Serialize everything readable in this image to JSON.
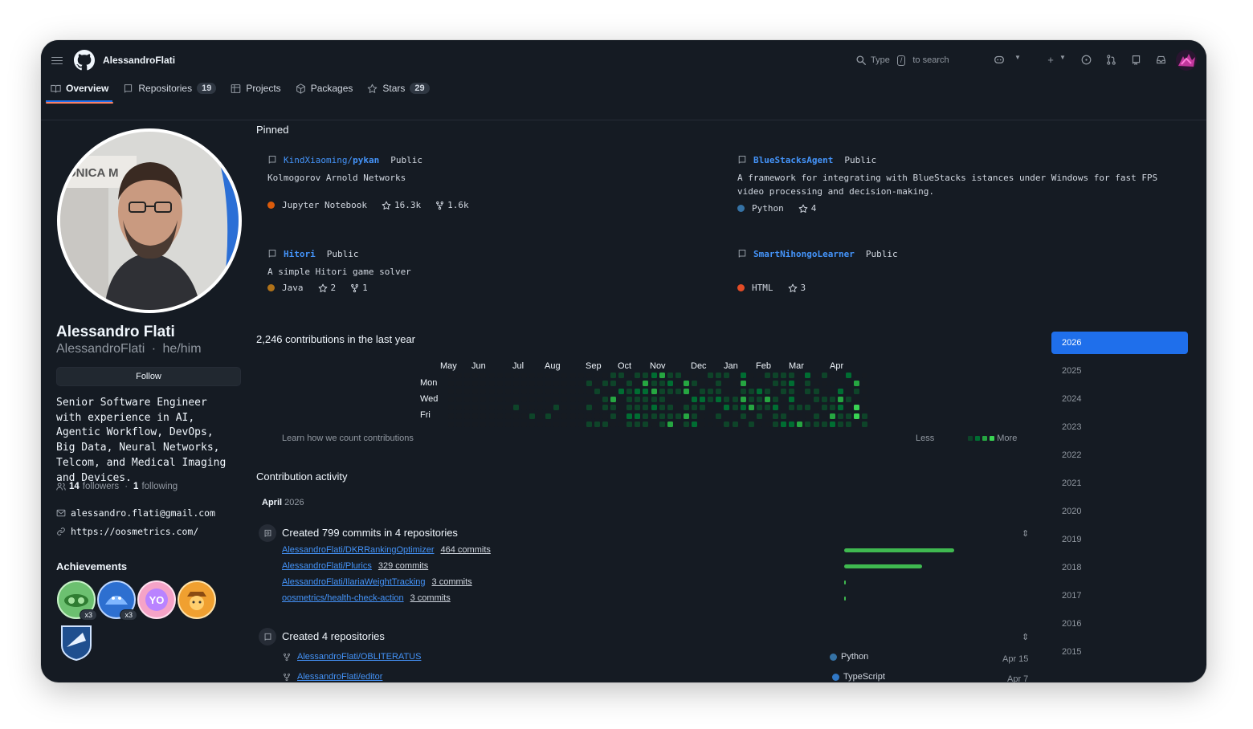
{
  "header": {
    "owner": "AlessandroFlati",
    "search_prefix": "Type",
    "search_key": "/",
    "search_suffix": "to search"
  },
  "tabs": [
    {
      "label": "Overview"
    },
    {
      "label": "Repositories",
      "count": "19"
    },
    {
      "label": "Projects"
    },
    {
      "label": "Packages"
    },
    {
      "label": "Stars",
      "count": "29"
    }
  ],
  "profile": {
    "name": "Alessandro Flati",
    "handle": "AlessandroFlati",
    "pronouns": "he/him",
    "follow_label": "Follow",
    "bio": "Senior Software Engineer with experience in AI, Agentic Workflow, DevOps, Big Data, Neural Networks, Telcom, and Medical Imaging and Devices.",
    "followers": "14",
    "followers_label": "followers",
    "following": "1",
    "following_label": "following",
    "email": "alessandro.flati@gmail.com",
    "website": "https://oosmetrics.com/",
    "photo_text": "ONICA M"
  },
  "achievements": {
    "title": "Achievements",
    "badges": [
      {
        "name": "pair-extraordinaire",
        "count": "x3"
      },
      {
        "name": "pull-shark",
        "count": "x3"
      },
      {
        "name": "yolo",
        "count": ""
      },
      {
        "name": "quickdraw",
        "count": ""
      },
      {
        "name": "arctic-code-vault",
        "count": ""
      }
    ]
  },
  "pinned": {
    "title": "Pinned",
    "items": [
      {
        "owner": "KindXiaoming/",
        "repo": "pykan",
        "visibility": "Public",
        "description": "Kolmogorov Arnold Networks",
        "language": "Jupyter Notebook",
        "lang_color": "#da5b0b",
        "stars": "16.3k",
        "forks": "1.6k"
      },
      {
        "owner": "",
        "repo": "BlueStacksAgent",
        "visibility": "Public",
        "description": "A framework for integrating with BlueStacks istances under Windows for fast FPS video processing and decision-making.",
        "language": "Python",
        "lang_color": "#3572a5",
        "stars": "4",
        "forks": ""
      },
      {
        "owner": "",
        "repo": "Hitori",
        "visibility": "Public",
        "description": "A simple Hitori game solver",
        "language": "Java",
        "lang_color": "#b07219",
        "stars": "2",
        "forks": "1"
      },
      {
        "owner": "",
        "repo": "SmartNihongoLearner",
        "visibility": "Public",
        "description": "",
        "language": "HTML",
        "lang_color": "#e34c26",
        "stars": "3",
        "forks": ""
      }
    ]
  },
  "contributions": {
    "title": "2,246 contributions in the last year",
    "months": [
      "May",
      "Jun",
      "Jul",
      "Aug",
      "Sep",
      "Oct",
      "Nov",
      "Dec",
      "Jan",
      "Feb",
      "Mar",
      "Apr"
    ],
    "days": [
      "Mon",
      "Wed",
      "Fri"
    ],
    "learn_link": "Learn how we count contributions",
    "legend_less": "Less",
    "legend_more": "More",
    "colors": [
      "#161b22",
      "#0e4429",
      "#006d32",
      "#26a641",
      "#39d353"
    ]
  },
  "years": [
    "2026",
    "2025",
    "2024",
    "2023",
    "2022",
    "2021",
    "2020",
    "2019",
    "2018",
    "2017",
    "2016",
    "2015"
  ],
  "activity": {
    "title": "Contribution activity",
    "month": "April",
    "year": "2026",
    "commits_title": "Created 799 commits in 4 repositories",
    "commits": [
      {
        "repo": "AlessandroFlati/DKRRankingOptimizer",
        "count": "464 commits",
        "share": 0.58
      },
      {
        "repo": "AlessandroFlati/Plurics",
        "count": "329 commits",
        "share": 0.41
      },
      {
        "repo": "AlessandroFlati/IlariaWeightTracking",
        "count": "3 commits",
        "share": 0.004
      },
      {
        "repo": "oosmetrics/health-check-action",
        "count": "3 commits",
        "share": 0.004
      }
    ],
    "repos_title": "Created 4 repositories",
    "repos": [
      {
        "repo": "AlessandroFlati/OBLITERATUS",
        "language": "Python",
        "lang_color": "#3572a5",
        "date": "Apr 15"
      },
      {
        "repo": "AlessandroFlati/editor",
        "language": "TypeScript",
        "lang_color": "#3178c6",
        "date": "Apr 7"
      }
    ]
  }
}
